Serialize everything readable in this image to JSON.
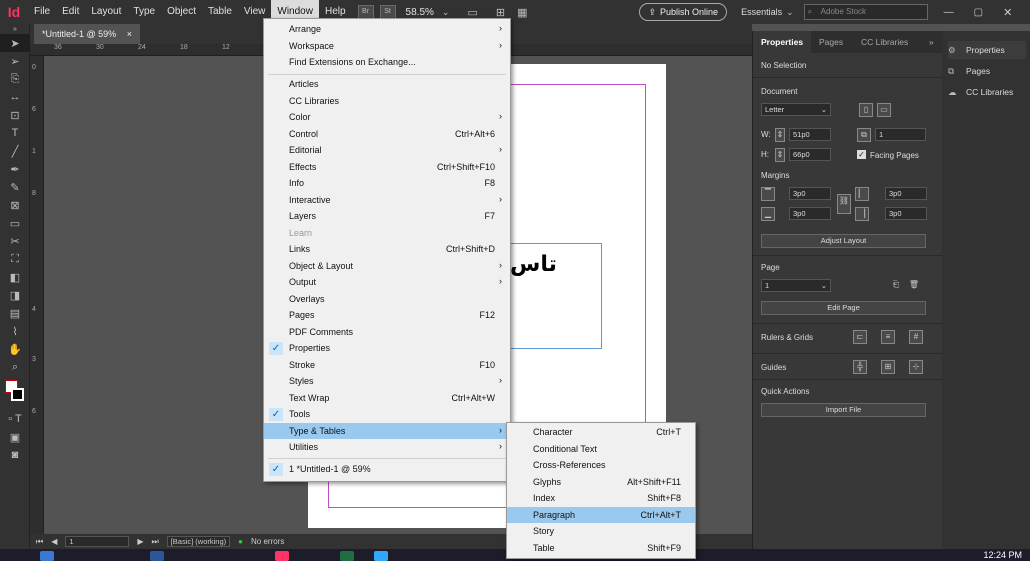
{
  "app": {
    "logo": "Id"
  },
  "menubar": {
    "items": [
      "File",
      "Edit",
      "Layout",
      "Type",
      "Object",
      "Table",
      "View",
      "Window",
      "Help"
    ],
    "active": "Window",
    "badge1": "Br",
    "badge2": "St",
    "zoom": "58.5%",
    "publish_label": "Publish Online",
    "workspace": "Essentials",
    "search_placeholder": "Adobe Stock"
  },
  "document_tab": {
    "title": "*Untitled-1 @ 59%",
    "close": "×"
  },
  "ruler": {
    "h_ticks": [
      "36",
      "30",
      "24",
      "18",
      "12"
    ],
    "v_ticks": [
      "0",
      "6",
      "1",
      "8",
      "4",
      "3",
      "6"
    ]
  },
  "canvas": {
    "frame_text": "تاس"
  },
  "window_menu": {
    "items": [
      {
        "label": "Arrange",
        "shortcut": "",
        "submenu": true
      },
      {
        "label": "Workspace",
        "shortcut": "",
        "submenu": true
      },
      {
        "label": "Find Extensions on Exchange...",
        "shortcut": ""
      },
      {
        "label": "Articles",
        "shortcut": ""
      },
      {
        "label": "CC Libraries",
        "shortcut": ""
      },
      {
        "label": "Color",
        "shortcut": "",
        "submenu": true
      },
      {
        "label": "Control",
        "shortcut": "Ctrl+Alt+6"
      },
      {
        "label": "Editorial",
        "shortcut": "",
        "submenu": true
      },
      {
        "label": "Effects",
        "shortcut": "Ctrl+Shift+F10"
      },
      {
        "label": "Info",
        "shortcut": "F8"
      },
      {
        "label": "Interactive",
        "shortcut": "",
        "submenu": true
      },
      {
        "label": "Layers",
        "shortcut": "F7"
      },
      {
        "label": "Learn",
        "shortcut": "",
        "disabled": true
      },
      {
        "label": "Links",
        "shortcut": "Ctrl+Shift+D"
      },
      {
        "label": "Object & Layout",
        "shortcut": "",
        "submenu": true
      },
      {
        "label": "Output",
        "shortcut": "",
        "submenu": true
      },
      {
        "label": "Overlays",
        "shortcut": ""
      },
      {
        "label": "Pages",
        "shortcut": "F12"
      },
      {
        "label": "PDF Comments",
        "shortcut": ""
      },
      {
        "label": "Properties",
        "shortcut": "",
        "checked": true
      },
      {
        "label": "Stroke",
        "shortcut": "F10"
      },
      {
        "label": "Styles",
        "shortcut": "",
        "submenu": true
      },
      {
        "label": "Text Wrap",
        "shortcut": "Ctrl+Alt+W"
      },
      {
        "label": "Tools",
        "shortcut": "",
        "checked": true
      },
      {
        "label": "Type & Tables",
        "shortcut": "",
        "submenu": true,
        "highlighted": true
      },
      {
        "label": "Utilities",
        "shortcut": "",
        "submenu": true
      },
      {
        "label": "1 *Untitled-1 @ 59%",
        "shortcut": "",
        "checked": true
      }
    ]
  },
  "type_tables_submenu": {
    "items": [
      {
        "label": "Character",
        "shortcut": "Ctrl+T"
      },
      {
        "label": "Conditional Text",
        "shortcut": ""
      },
      {
        "label": "Cross-References",
        "shortcut": ""
      },
      {
        "label": "Glyphs",
        "shortcut": "Alt+Shift+F11"
      },
      {
        "label": "Index",
        "shortcut": "Shift+F8"
      },
      {
        "label": "Paragraph",
        "shortcut": "Ctrl+Alt+T",
        "highlighted": true
      },
      {
        "label": "Story",
        "shortcut": ""
      },
      {
        "label": "Table",
        "shortcut": "Shift+F9"
      }
    ]
  },
  "properties_panel": {
    "tabs": [
      "Properties",
      "Pages",
      "CC Libraries"
    ],
    "collapse": "»",
    "selection": "No Selection",
    "document_label": "Document",
    "preset": "Letter",
    "w_label": "W:",
    "w_value": "51p0",
    "h_label": "H:",
    "h_value": "66p0",
    "pages_count": "1",
    "facing_pages": "Facing Pages",
    "margins_label": "Margins",
    "margin_top": "3p0",
    "margin_bottom": "3p0",
    "margin_left": "3p0",
    "margin_right": "3p0",
    "adjust_layout": "Adjust Layout",
    "page_label": "Page",
    "page_value": "1",
    "edit_page": "Edit Page",
    "rulers_grids": "Rulers & Grids",
    "guides": "Guides",
    "quick_actions": "Quick Actions",
    "import_file": "Import File"
  },
  "mini_panel": {
    "items": [
      "Properties",
      "Pages",
      "CC Libraries"
    ]
  },
  "statusbar": {
    "page": "1",
    "preset": "[Basic] (working)",
    "errors": "No errors"
  },
  "taskbar": {
    "time": "12:24 PM"
  },
  "colors": {
    "accent": "#ff3366",
    "highlight": "#99c9ef",
    "margin": "#c24dc2",
    "frame": "#5b9bd5"
  }
}
